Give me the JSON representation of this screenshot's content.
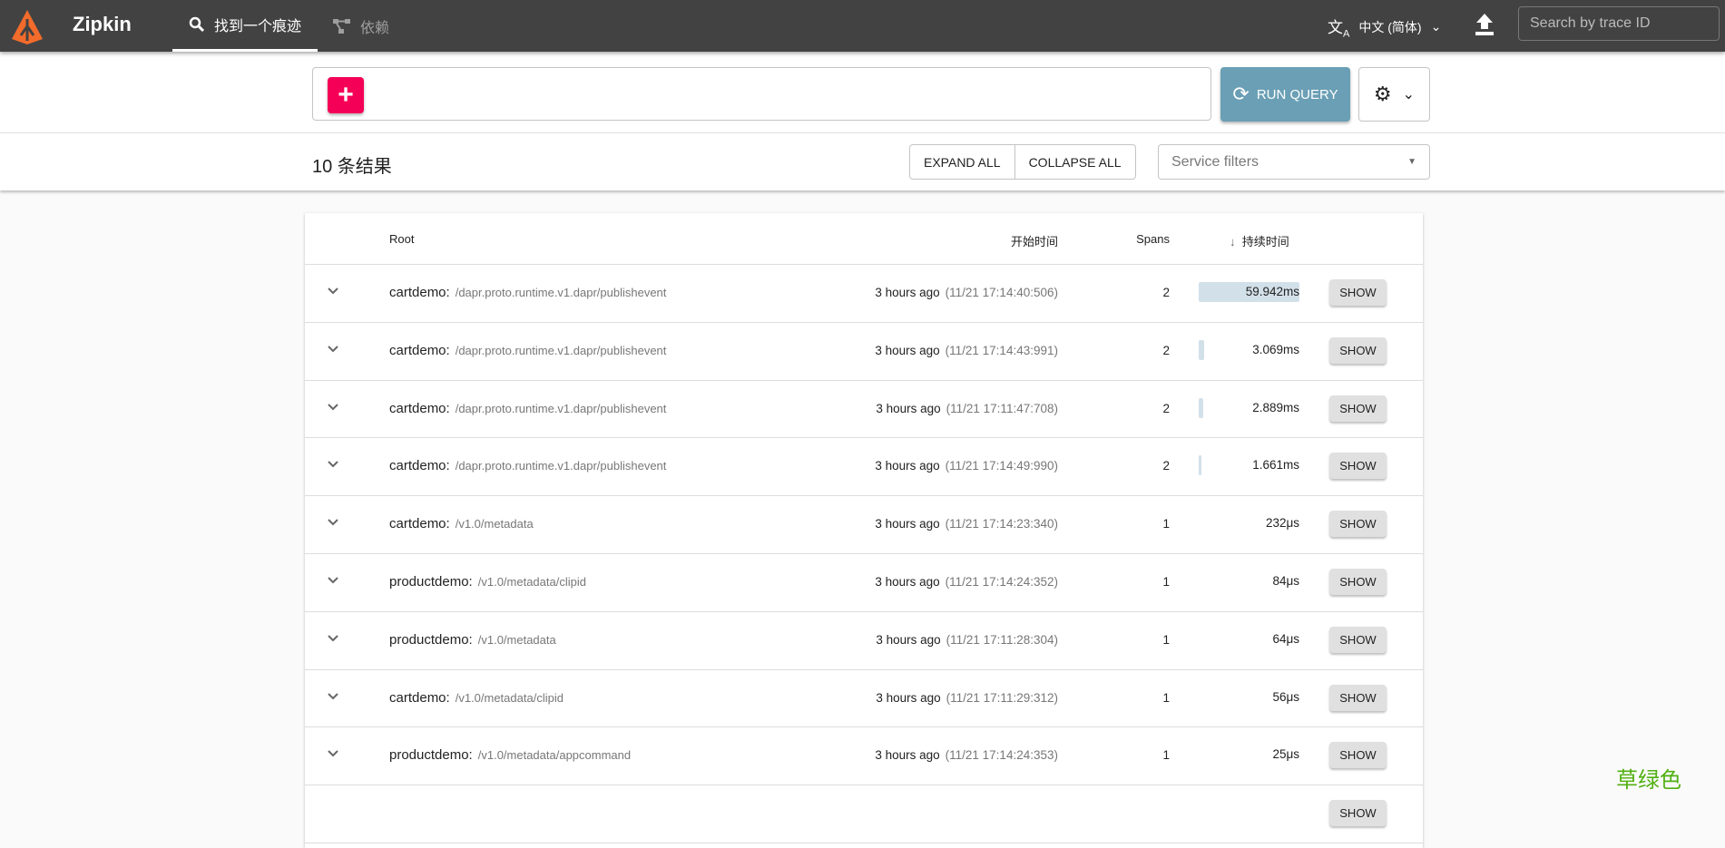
{
  "header": {
    "brand": "Zipkin",
    "tabs": [
      {
        "label": "找到一个痕迹"
      },
      {
        "label": "依赖"
      }
    ],
    "language": "中文 (简体)",
    "search_placeholder": "Search by trace ID"
  },
  "query": {
    "run_label": "RUN QUERY"
  },
  "results": {
    "count_label": "10 条结果",
    "expand_all": "EXPAND ALL",
    "collapse_all": "COLLAPSE ALL",
    "service_filter_placeholder": "Service filters"
  },
  "table": {
    "columns": {
      "root": "Root",
      "start": "开始时间",
      "spans": "Spans",
      "duration": "持续时间"
    },
    "show_label": "SHOW",
    "rows": [
      {
        "service": "cartdemo:",
        "path": "/dapr.proto.runtime.v1.dapr/publishevent",
        "ago": "3 hours ago",
        "ts": "(11/21 17:14:40:506)",
        "spans": "2",
        "duration": "59.942ms",
        "duration_ms": 59.942
      },
      {
        "service": "cartdemo:",
        "path": "/dapr.proto.runtime.v1.dapr/publishevent",
        "ago": "3 hours ago",
        "ts": "(11/21 17:14:43:991)",
        "spans": "2",
        "duration": "3.069ms",
        "duration_ms": 3.069
      },
      {
        "service": "cartdemo:",
        "path": "/dapr.proto.runtime.v1.dapr/publishevent",
        "ago": "3 hours ago",
        "ts": "(11/21 17:11:47:708)",
        "spans": "2",
        "duration": "2.889ms",
        "duration_ms": 2.889
      },
      {
        "service": "cartdemo:",
        "path": "/dapr.proto.runtime.v1.dapr/publishevent",
        "ago": "3 hours ago",
        "ts": "(11/21 17:14:49:990)",
        "spans": "2",
        "duration": "1.661ms",
        "duration_ms": 1.661
      },
      {
        "service": "cartdemo:",
        "path": "/v1.0/metadata",
        "ago": "3 hours ago",
        "ts": "(11/21 17:14:23:340)",
        "spans": "1",
        "duration": "232μs",
        "duration_ms": 0.232
      },
      {
        "service": "productdemo:",
        "path": "/v1.0/metadata/clipid",
        "ago": "3 hours ago",
        "ts": "(11/21 17:14:24:352)",
        "spans": "1",
        "duration": "84μs",
        "duration_ms": 0.084
      },
      {
        "service": "productdemo:",
        "path": "/v1.0/metadata",
        "ago": "3 hours ago",
        "ts": "(11/21 17:11:28:304)",
        "spans": "1",
        "duration": "64μs",
        "duration_ms": 0.064
      },
      {
        "service": "cartdemo:",
        "path": "/v1.0/metadata/clipid",
        "ago": "3 hours ago",
        "ts": "(11/21 17:11:29:312)",
        "spans": "1",
        "duration": "56μs",
        "duration_ms": 0.056
      },
      {
        "service": "productdemo:",
        "path": "/v1.0/metadata/appcommand",
        "ago": "3 hours ago",
        "ts": "(11/21 17:14:24:353)",
        "spans": "1",
        "duration": "25μs",
        "duration_ms": 0.025
      }
    ]
  },
  "overlay_text": "草绿色"
}
